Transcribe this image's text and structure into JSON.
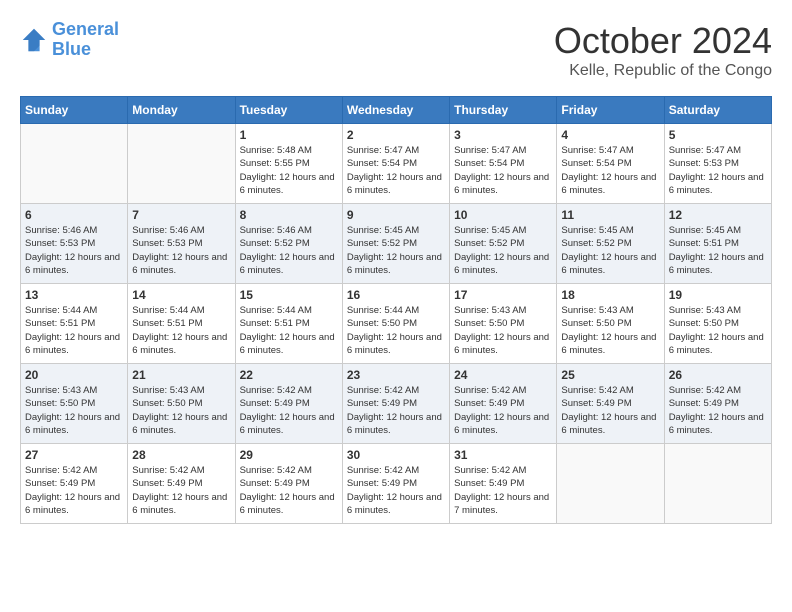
{
  "header": {
    "logo_line1": "General",
    "logo_line2": "Blue",
    "month_title": "October 2024",
    "location": "Kelle, Republic of the Congo"
  },
  "days_of_week": [
    "Sunday",
    "Monday",
    "Tuesday",
    "Wednesday",
    "Thursday",
    "Friday",
    "Saturday"
  ],
  "weeks": [
    [
      {
        "num": "",
        "empty": true
      },
      {
        "num": "",
        "empty": true
      },
      {
        "num": "1",
        "sunrise": "5:48 AM",
        "sunset": "5:55 PM",
        "daylight": "12 hours and 6 minutes."
      },
      {
        "num": "2",
        "sunrise": "5:47 AM",
        "sunset": "5:54 PM",
        "daylight": "12 hours and 6 minutes."
      },
      {
        "num": "3",
        "sunrise": "5:47 AM",
        "sunset": "5:54 PM",
        "daylight": "12 hours and 6 minutes."
      },
      {
        "num": "4",
        "sunrise": "5:47 AM",
        "sunset": "5:54 PM",
        "daylight": "12 hours and 6 minutes."
      },
      {
        "num": "5",
        "sunrise": "5:47 AM",
        "sunset": "5:53 PM",
        "daylight": "12 hours and 6 minutes."
      }
    ],
    [
      {
        "num": "6",
        "sunrise": "5:46 AM",
        "sunset": "5:53 PM",
        "daylight": "12 hours and 6 minutes."
      },
      {
        "num": "7",
        "sunrise": "5:46 AM",
        "sunset": "5:53 PM",
        "daylight": "12 hours and 6 minutes."
      },
      {
        "num": "8",
        "sunrise": "5:46 AM",
        "sunset": "5:52 PM",
        "daylight": "12 hours and 6 minutes."
      },
      {
        "num": "9",
        "sunrise": "5:45 AM",
        "sunset": "5:52 PM",
        "daylight": "12 hours and 6 minutes."
      },
      {
        "num": "10",
        "sunrise": "5:45 AM",
        "sunset": "5:52 PM",
        "daylight": "12 hours and 6 minutes."
      },
      {
        "num": "11",
        "sunrise": "5:45 AM",
        "sunset": "5:52 PM",
        "daylight": "12 hours and 6 minutes."
      },
      {
        "num": "12",
        "sunrise": "5:45 AM",
        "sunset": "5:51 PM",
        "daylight": "12 hours and 6 minutes."
      }
    ],
    [
      {
        "num": "13",
        "sunrise": "5:44 AM",
        "sunset": "5:51 PM",
        "daylight": "12 hours and 6 minutes."
      },
      {
        "num": "14",
        "sunrise": "5:44 AM",
        "sunset": "5:51 PM",
        "daylight": "12 hours and 6 minutes."
      },
      {
        "num": "15",
        "sunrise": "5:44 AM",
        "sunset": "5:51 PM",
        "daylight": "12 hours and 6 minutes."
      },
      {
        "num": "16",
        "sunrise": "5:44 AM",
        "sunset": "5:50 PM",
        "daylight": "12 hours and 6 minutes."
      },
      {
        "num": "17",
        "sunrise": "5:43 AM",
        "sunset": "5:50 PM",
        "daylight": "12 hours and 6 minutes."
      },
      {
        "num": "18",
        "sunrise": "5:43 AM",
        "sunset": "5:50 PM",
        "daylight": "12 hours and 6 minutes."
      },
      {
        "num": "19",
        "sunrise": "5:43 AM",
        "sunset": "5:50 PM",
        "daylight": "12 hours and 6 minutes."
      }
    ],
    [
      {
        "num": "20",
        "sunrise": "5:43 AM",
        "sunset": "5:50 PM",
        "daylight": "12 hours and 6 minutes."
      },
      {
        "num": "21",
        "sunrise": "5:43 AM",
        "sunset": "5:50 PM",
        "daylight": "12 hours and 6 minutes."
      },
      {
        "num": "22",
        "sunrise": "5:42 AM",
        "sunset": "5:49 PM",
        "daylight": "12 hours and 6 minutes."
      },
      {
        "num": "23",
        "sunrise": "5:42 AM",
        "sunset": "5:49 PM",
        "daylight": "12 hours and 6 minutes."
      },
      {
        "num": "24",
        "sunrise": "5:42 AM",
        "sunset": "5:49 PM",
        "daylight": "12 hours and 6 minutes."
      },
      {
        "num": "25",
        "sunrise": "5:42 AM",
        "sunset": "5:49 PM",
        "daylight": "12 hours and 6 minutes."
      },
      {
        "num": "26",
        "sunrise": "5:42 AM",
        "sunset": "5:49 PM",
        "daylight": "12 hours and 6 minutes."
      }
    ],
    [
      {
        "num": "27",
        "sunrise": "5:42 AM",
        "sunset": "5:49 PM",
        "daylight": "12 hours and 6 minutes."
      },
      {
        "num": "28",
        "sunrise": "5:42 AM",
        "sunset": "5:49 PM",
        "daylight": "12 hours and 6 minutes."
      },
      {
        "num": "29",
        "sunrise": "5:42 AM",
        "sunset": "5:49 PM",
        "daylight": "12 hours and 6 minutes."
      },
      {
        "num": "30",
        "sunrise": "5:42 AM",
        "sunset": "5:49 PM",
        "daylight": "12 hours and 6 minutes."
      },
      {
        "num": "31",
        "sunrise": "5:42 AM",
        "sunset": "5:49 PM",
        "daylight": "12 hours and 7 minutes."
      },
      {
        "num": "",
        "empty": true
      },
      {
        "num": "",
        "empty": true
      }
    ]
  ],
  "labels": {
    "sunrise_prefix": "Sunrise: ",
    "sunset_prefix": "Sunset: ",
    "daylight_prefix": "Daylight: "
  }
}
